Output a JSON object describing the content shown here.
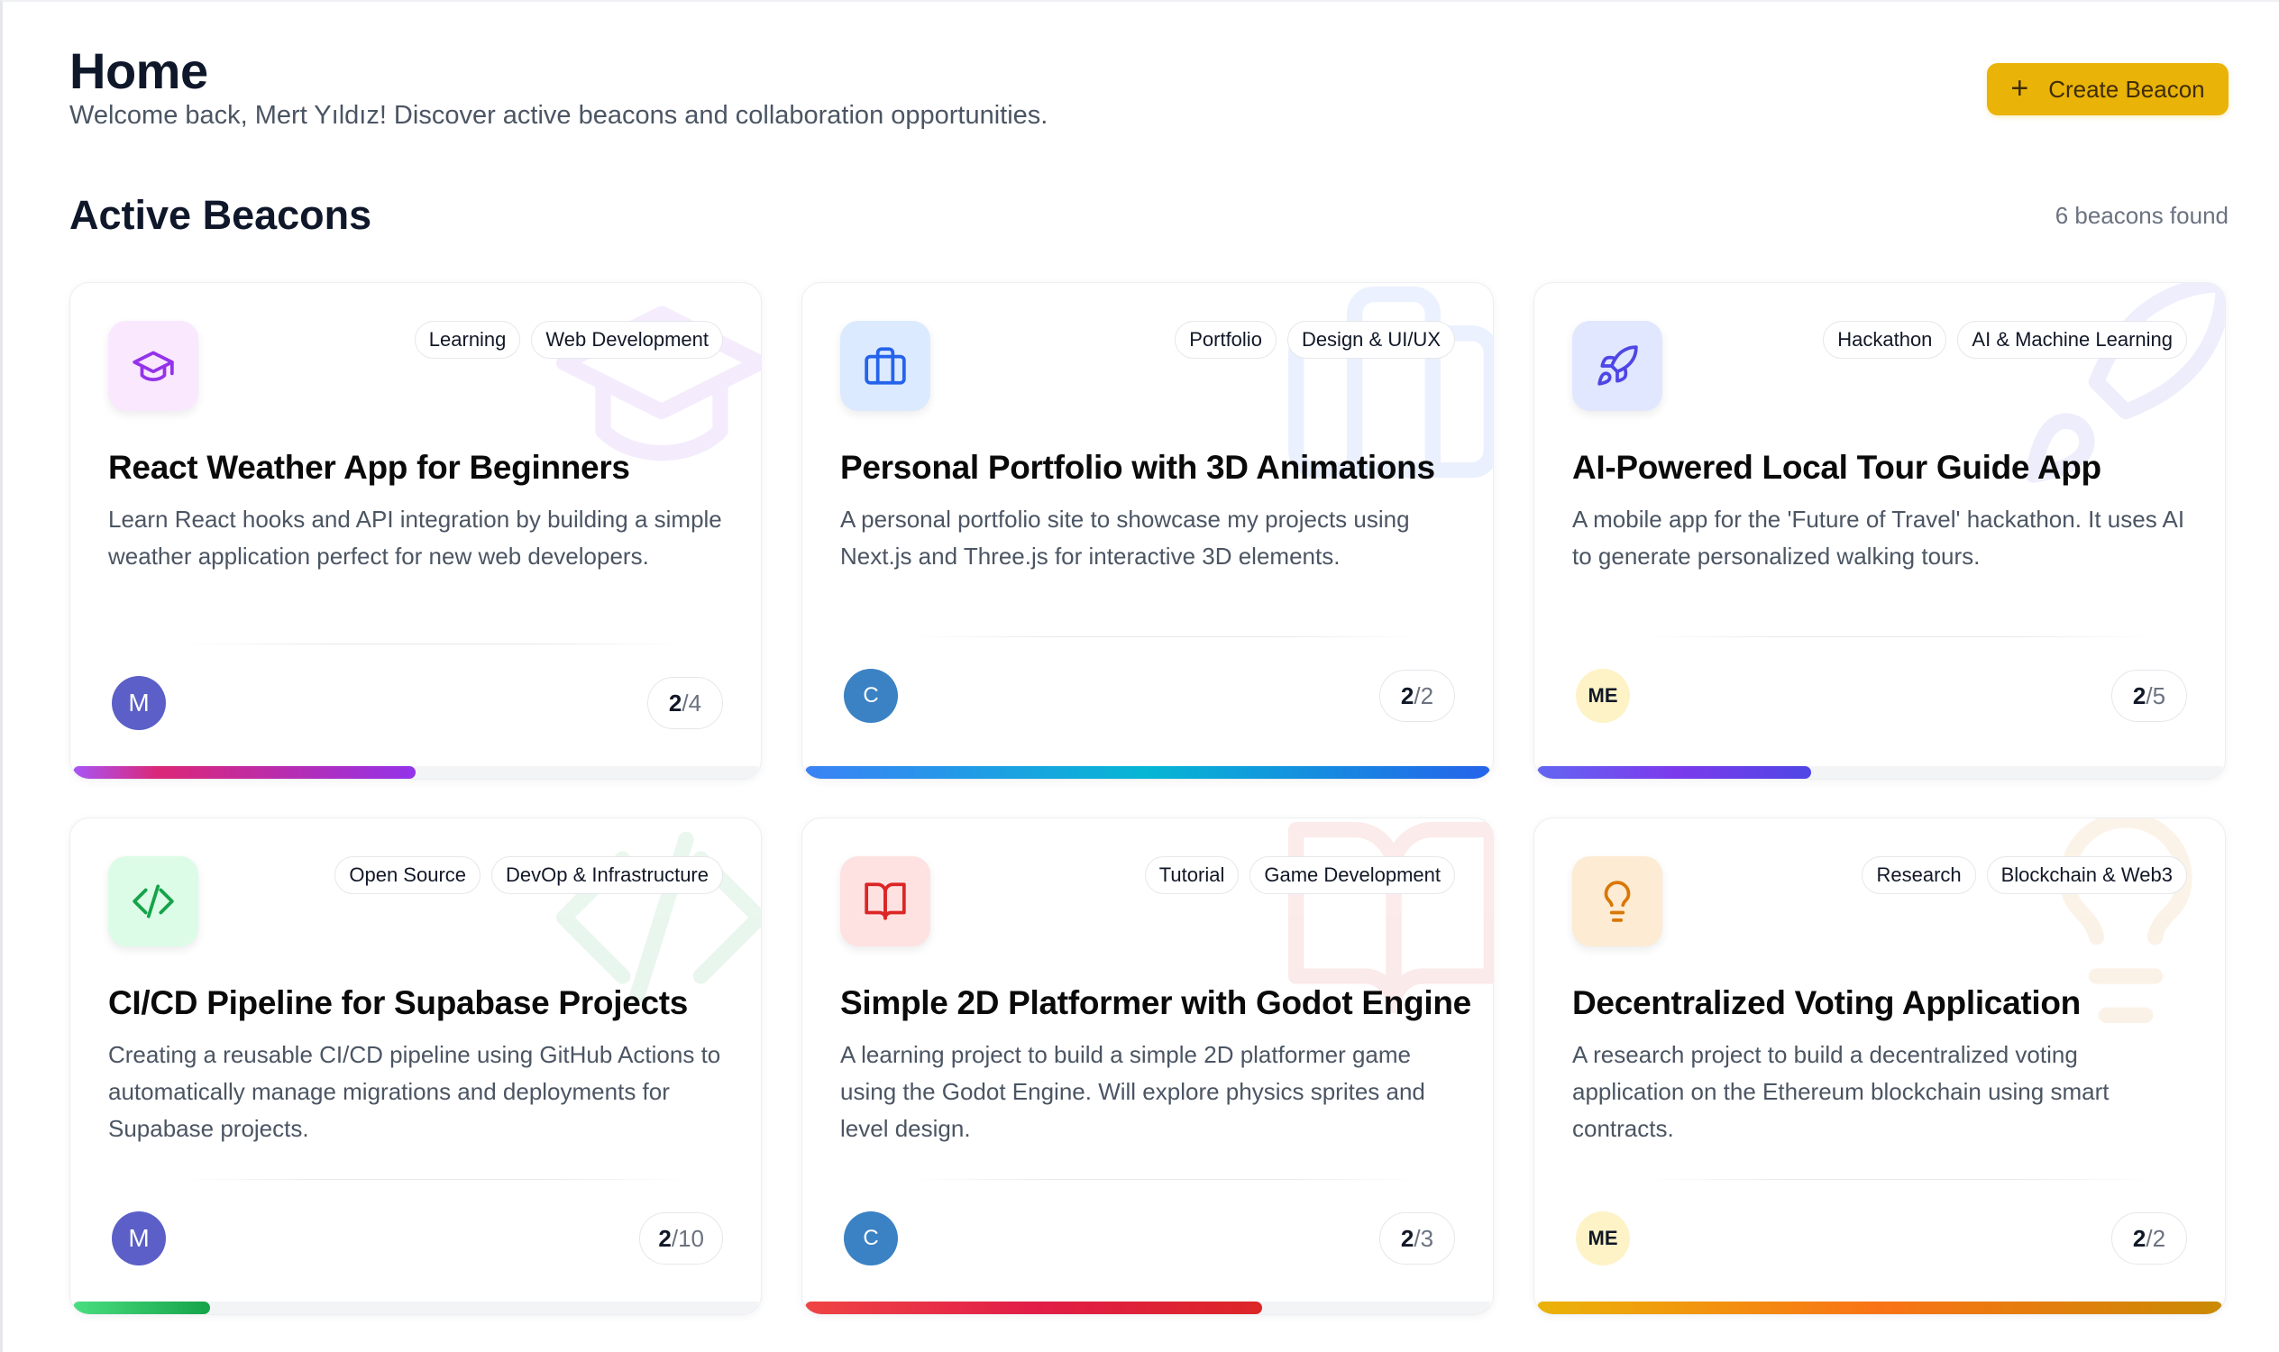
{
  "header": {
    "title": "Home",
    "subtitle": "Welcome back, Mert Yıldız! Discover active beacons and collaboration opportunities.",
    "create_button_label": "Create Beacon",
    "create_button_icon": "plus-icon"
  },
  "section": {
    "title": "Active Beacons",
    "count_text": "6 beacons found"
  },
  "colors": {
    "accent": "#eab308",
    "purple": "#9333ea",
    "blue": "#2563eb",
    "indigo": "#4f46e5",
    "green": "#16a34a",
    "red": "#dc2626",
    "amber": "#d97706"
  },
  "beacons": [
    {
      "title": "React Weather App for Beginners",
      "description": "Learn React hooks and API integration by building a simple weather application perfect for new web developers.",
      "tags": [
        "Learning",
        "Web Development"
      ],
      "icon": "graduation-cap-icon",
      "avatar_text": "M",
      "filled": "2",
      "total": "/4",
      "progress": 0.5
    },
    {
      "title": "Personal Portfolio with 3D Animations",
      "description": "A personal portfolio site to showcase my projects using Next.js and Three.js for interactive 3D elements.",
      "tags": [
        "Portfolio",
        "Design & UI/UX"
      ],
      "icon": "briefcase-icon",
      "avatar_text": "C",
      "filled": "2",
      "total": "/2",
      "progress": 1.0
    },
    {
      "title": "AI-Powered Local Tour Guide App",
      "description": "A mobile app for the 'Future of Travel' hackathon. It uses AI to generate personalized walking tours.",
      "tags": [
        "Hackathon",
        "AI & Machine Learning"
      ],
      "icon": "rocket-icon",
      "avatar_text": "ME",
      "filled": "2",
      "total": "/5",
      "progress": 0.4
    },
    {
      "title": "CI/CD Pipeline for Supabase Projects",
      "description": "Creating a reusable CI/CD pipeline using GitHub Actions to automatically manage migrations and deployments for Supabase projects.",
      "tags": [
        "Open Source",
        "DevOp & Infrastructure"
      ],
      "icon": "code-icon",
      "avatar_text": "M",
      "filled": "2",
      "total": "/10",
      "progress": 0.2
    },
    {
      "title": "Simple 2D Platformer with Godot Engine",
      "description": "A learning project to build a simple 2D platformer game using the Godot Engine. Will explore physics sprites and level design.",
      "tags": [
        "Tutorial",
        "Game Development"
      ],
      "icon": "book-open-icon",
      "avatar_text": "C",
      "filled": "2",
      "total": "/3",
      "progress": 0.667
    },
    {
      "title": "Decentralized Voting Application",
      "description": "A research project to build a decentralized voting application on the Ethereum blockchain using smart contracts.",
      "tags": [
        "Research",
        "Blockchain & Web3"
      ],
      "icon": "lightbulb-icon",
      "avatar_text": "ME",
      "filled": "2",
      "total": "/2",
      "progress": 1.0
    }
  ]
}
